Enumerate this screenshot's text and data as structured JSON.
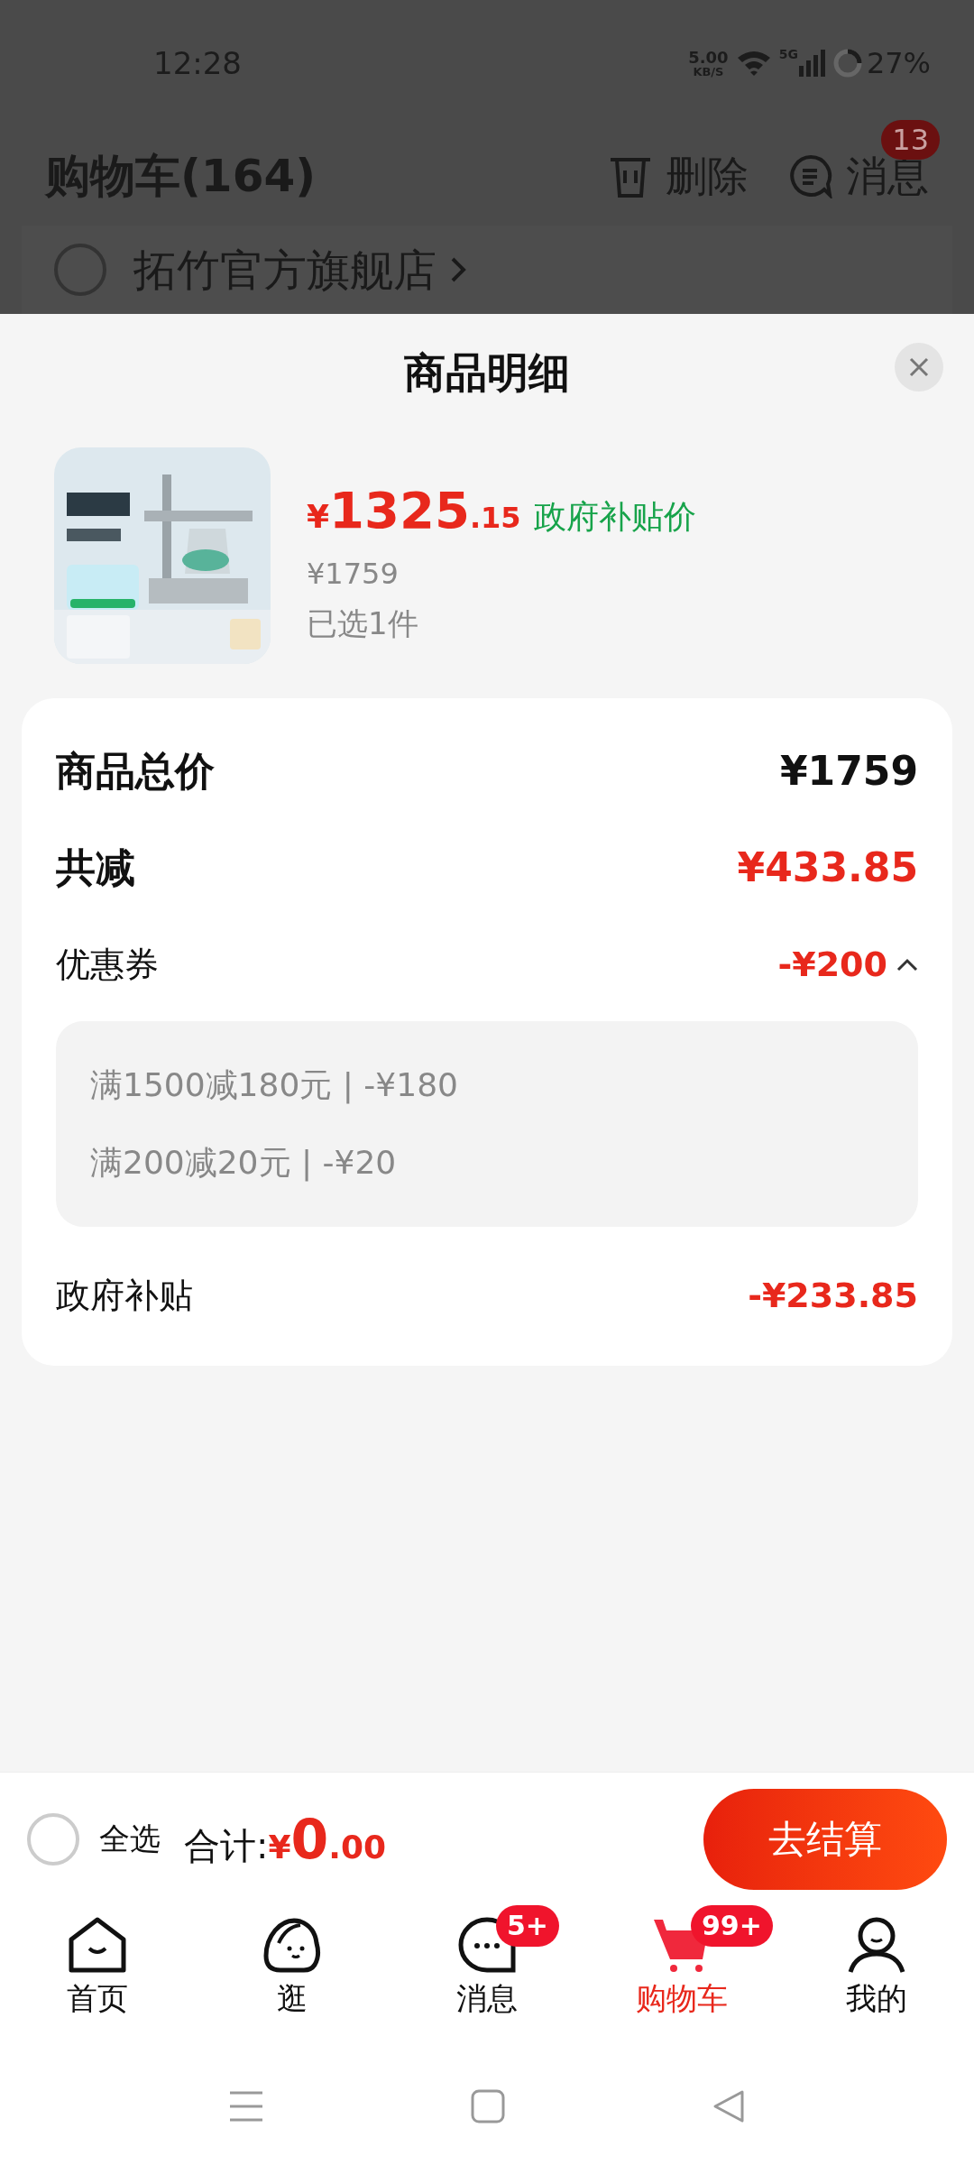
{
  "status_bar": {
    "time": "12:28",
    "net_speed": "5.00",
    "net_unit": "KB/S",
    "network": "5G",
    "battery": "27%"
  },
  "header": {
    "title": "购物车(164)",
    "actions": [
      {
        "kind": "delete",
        "label": "删除"
      },
      {
        "kind": "message",
        "label": "消息",
        "badge": "13"
      }
    ]
  },
  "store": {
    "name": "拓竹官方旗舰店",
    "checked": false
  },
  "sheet": {
    "title": "商品明细",
    "product": {
      "currency": "¥",
      "price_integer": "1325",
      "price_decimal": ".15",
      "price_tag": "政府补贴价",
      "original_price": "¥1759",
      "selected_count": "已选1件"
    },
    "summary": {
      "total_label": "商品总价",
      "total_value": "¥1759",
      "discount_label": "共减",
      "discount_value": "¥433.85",
      "coupon": {
        "label": "优惠券",
        "value": "-¥200",
        "expanded": true,
        "details": [
          "满1500减180元 | -¥180",
          "满200减20元 | -¥20"
        ]
      },
      "subsidy": {
        "label": "政府补贴",
        "value": "-¥233.85"
      }
    }
  },
  "bottom_bar": {
    "select_all": {
      "label": "全选",
      "checked": false
    },
    "total_label": "合计:",
    "currency": "¥",
    "total_integer": "0",
    "total_decimal": ".00",
    "checkout": "去结算"
  },
  "nav": [
    {
      "kind": "home",
      "label": "首页",
      "selected": false
    },
    {
      "kind": "browse",
      "label": "逛",
      "selected": false
    },
    {
      "kind": "message",
      "label": "消息",
      "badge": "5+",
      "selected": false
    },
    {
      "kind": "cart",
      "label": "购物车",
      "badge": "99+",
      "selected": true
    },
    {
      "kind": "profile",
      "label": "我的",
      "selected": false
    }
  ]
}
